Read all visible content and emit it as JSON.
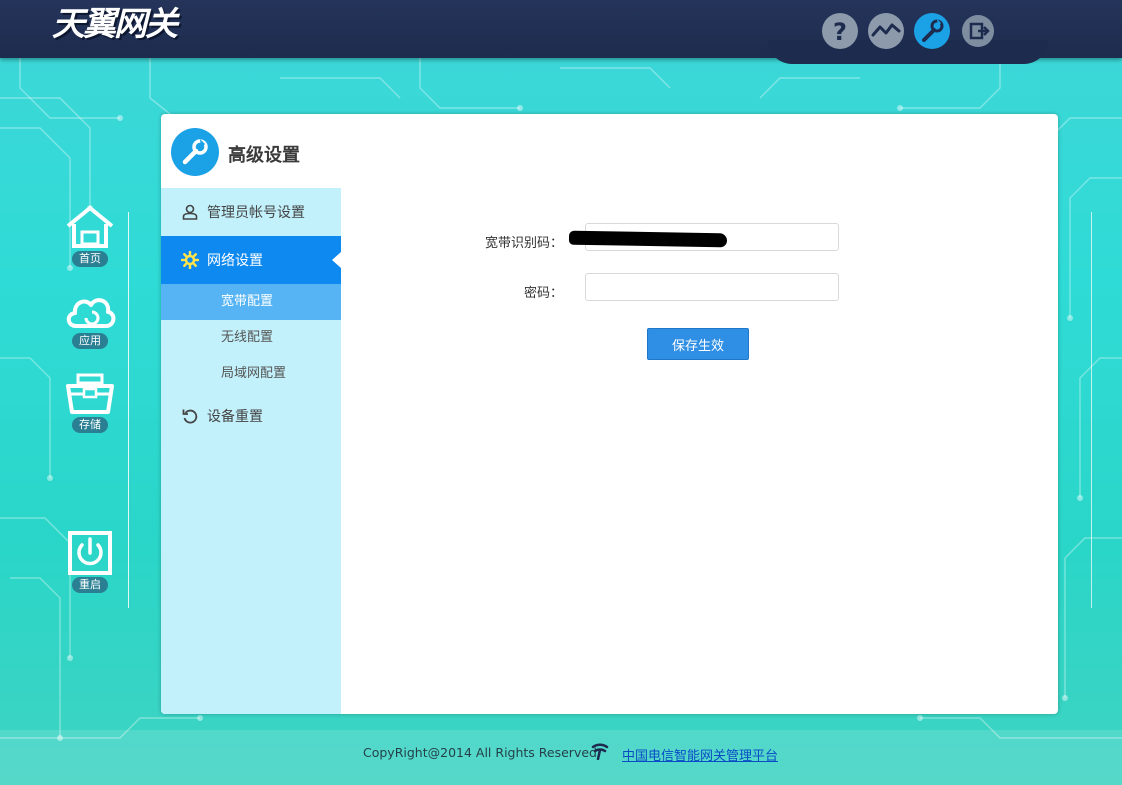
{
  "header": {
    "logo_text": "天翼网关",
    "icons": [
      "help-icon",
      "status-icon",
      "settings-icon",
      "logout-icon"
    ]
  },
  "left_nav": {
    "items": [
      {
        "label": "首页",
        "icon": "home-icon"
      },
      {
        "label": "应用",
        "icon": "cloud-icon"
      },
      {
        "label": "存储",
        "icon": "storage-icon"
      },
      {
        "label": "重启",
        "icon": "power-icon"
      }
    ]
  },
  "panel": {
    "title": "高级设置",
    "menu": {
      "admin": "管理员帐号设置",
      "network": "网络设置",
      "broadband": "宽带配置",
      "wireless": "无线配置",
      "lan": "局域网配置",
      "reset": "设备重置"
    },
    "form": {
      "account_label": "宽带识别码：",
      "account_value": "",
      "password_label": "密码：",
      "password_value": "",
      "save_label": "保存生效"
    }
  },
  "footer": {
    "copyright": "CopyRight@2014 All Rights Reserved",
    "link_text": "中国电信智能网关管理平台"
  },
  "colors": {
    "header_bg": "#1d2b4e",
    "accent": "#0e89f0",
    "sub_active": "#56b4f4",
    "sidebar_bg": "#c2f1fb",
    "button": "#2f8fe4"
  }
}
